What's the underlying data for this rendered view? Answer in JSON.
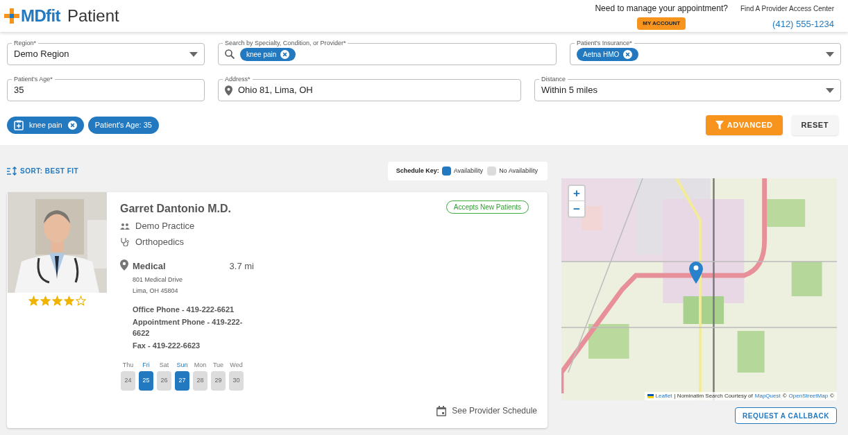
{
  "header": {
    "logo": "MDfit",
    "title": "Patient",
    "prompt": "Need to manage your appointment?",
    "account_button": "MY ACCOUNT",
    "access_center": "Find A Provider Access Center",
    "phone": "(412) 555-1234"
  },
  "region": {
    "label": "Region*",
    "value": "Demo Region"
  },
  "search": {
    "label": "Search by Specialty, Condition, or Provider*",
    "chips": [
      "knee pain"
    ]
  },
  "insurance": {
    "label": "Patient's Insurance*",
    "chips": [
      "Aetna HMO"
    ]
  },
  "age": {
    "label": "Patient's Age*",
    "value": "35"
  },
  "address": {
    "label": "Address*",
    "value": "Ohio 81, Lima, OH"
  },
  "distance": {
    "label": "Distance",
    "value": "Within 5 miles"
  },
  "active_filters": [
    {
      "kind": "condition",
      "label": "knee pain"
    },
    {
      "kind": "age",
      "label": "Patient's Age: 35"
    }
  ],
  "advanced_button": "ADVANCED",
  "reset_button": "RESET",
  "sort": "SORT: BEST FIT",
  "schedule_key": {
    "title": "Schedule Key:",
    "items": [
      {
        "label": "Availability",
        "color": "#2379c0"
      },
      {
        "label": "No Availability",
        "color": "#dcdcdc"
      }
    ]
  },
  "providers": [
    {
      "name": "Garret Dantonio M.D.",
      "stars": 4,
      "badge": "Accepts New Patients",
      "practice": "Demo Practice",
      "specialty": "Orthopedics",
      "location": {
        "name": "Medical",
        "distance": "3.7 mi",
        "address": [
          "801 Medical Drive",
          "Lima, OH 45804"
        ]
      },
      "phones": [
        "Office Phone - 419-222-6621",
        "Appointment Phone - 419-222-6622",
        "Fax - 419-222-6623"
      ],
      "schedule": [
        {
          "day": "Thu",
          "date": "24",
          "available": false
        },
        {
          "day": "Fri",
          "date": "25",
          "available": true
        },
        {
          "day": "Sat",
          "date": "26",
          "available": false
        },
        {
          "day": "Sun",
          "date": "27",
          "available": true
        },
        {
          "day": "Mon",
          "date": "28",
          "available": false
        },
        {
          "day": "Tue",
          "date": "29",
          "available": false
        },
        {
          "day": "Wed",
          "date": "30",
          "available": false
        }
      ],
      "schedule_link": "See Provider Schedule"
    }
  ],
  "map": {
    "zoom_in": "+",
    "zoom_out": "−",
    "attribution": [
      {
        "kind": "link",
        "text": "Leaflet"
      },
      {
        "kind": "text",
        "text": "| Nominatim Search Courtesy of"
      },
      {
        "kind": "link",
        "text": "MapQuest"
      },
      {
        "kind": "text",
        "text": "©"
      },
      {
        "kind": "link",
        "text": "OpenStreetMap"
      },
      {
        "kind": "text",
        "text": "©"
      }
    ]
  },
  "callback_button": "REQUEST A CALLBACK"
}
